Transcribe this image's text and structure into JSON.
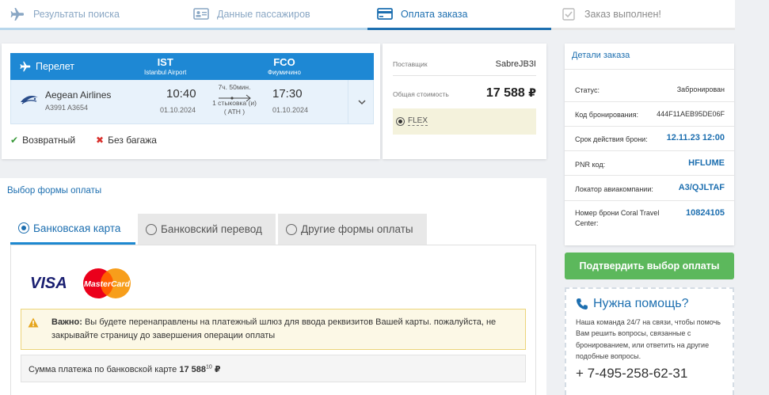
{
  "steps": [
    {
      "label": "Результаты поиска",
      "icon": "airplane-icon"
    },
    {
      "label": "Данные пассажиров",
      "icon": "id-card-icon"
    },
    {
      "label": "Оплата заказа",
      "icon": "credit-card-icon"
    },
    {
      "label": "Заказ выполнен!",
      "icon": "checkbox-icon"
    }
  ],
  "flight": {
    "header_label": "Перелет",
    "from_code": "IST",
    "from_airport": "Istanbul Airport",
    "to_code": "FCO",
    "to_airport": "Фиумичино",
    "airline": "Aegean Airlines",
    "flight_numbers": "A3991  A3654",
    "dep_time": "10:40",
    "dep_date": "01.10.2024",
    "arr_time": "17:30",
    "arr_date": "01.10.2024",
    "duration": "7ч. 50мин.",
    "stops": "1 стыковка (и)",
    "stop_city": "( ATH )",
    "tag_return": "Возвратный",
    "tag_baggage": "Без багажа"
  },
  "price": {
    "supplier_label": "Поставщик",
    "supplier_value": "SabreJB3I",
    "total_label": "Общая стоимость",
    "total_value": "17 588",
    "currency": "₽",
    "fare": "FLEX"
  },
  "payment": {
    "title": "Выбор формы оплаты",
    "tabs": [
      "Банковская карта",
      "Банковский перевод",
      "Другие формы оплаты"
    ],
    "visa": "VISA",
    "mastercard": "MasterCard",
    "warning_bold": "Важно:",
    "warning_text": " Вы будете перенаправлены на платежный шлюз для ввода реквизитов Вашей карты. пожалуйста, не закрывайте страницу до завершения операции оплаты",
    "sum_label": "Сумма платежа по банковской карте ",
    "sum_value": "17 588",
    "sum_cents": "10",
    "sum_currency": "₽"
  },
  "details": {
    "title": "Детали заказа",
    "rows": [
      {
        "key": "Статус:",
        "value": "Забронирован"
      },
      {
        "key": "Код бронирования:",
        "value": "444F11AEB95DE06F"
      },
      {
        "key": "Срок действия брони:",
        "value": "12.11.23 12:00"
      },
      {
        "key": "PNR код:",
        "value": "HFLUME"
      },
      {
        "key": "Локатор авиакомпании:",
        "value": "A3/QJLTAF"
      },
      {
        "key": "Номер брони Coral Travel Center:",
        "value": "10824105"
      }
    ]
  },
  "confirm_button": "Подтвердить выбор оплаты",
  "help": {
    "title": "Нужна помощь?",
    "text": "Наша команда 24/7 на связи, чтобы помочь Вам решить вопросы, связанные с бронированием, или ответить на другие подобные вопросы.",
    "phone": "+ 7-495-258-62-31"
  },
  "colors": {
    "accent": "#1d6fb0",
    "header_blue": "#1e88d4",
    "success": "#5cb85c",
    "warning_bg": "#fcf8e6"
  }
}
